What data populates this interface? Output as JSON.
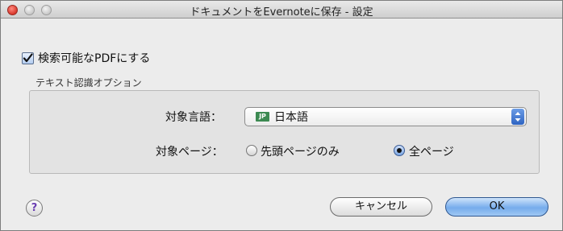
{
  "window": {
    "title": "ドキュメントをEvernoteに保存 - 設定"
  },
  "searchable_pdf": {
    "label": "検索可能なPDFにする",
    "checked": true
  },
  "ocr_group": {
    "title": "テキスト認識オプション",
    "language_label": "対象言語：",
    "language_flag": "JP",
    "language_value": "日本語",
    "pages_label": "対象ページ：",
    "pages_options": [
      {
        "label": "先頭ページのみ",
        "selected": false
      },
      {
        "label": "全ページ",
        "selected": true
      }
    ]
  },
  "footer": {
    "help_label": "?",
    "cancel_label": "キャンセル",
    "ok_label": "OK"
  },
  "colors": {
    "accent": "#3c76d8",
    "window_bg": "#ececec",
    "help_mark": "#6b3fb2"
  }
}
